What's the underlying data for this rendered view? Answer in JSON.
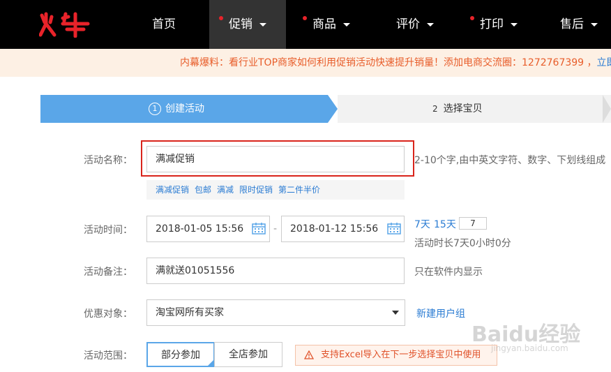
{
  "header": {
    "logo_text": "火牛",
    "nav": [
      {
        "label": "首页",
        "dot": false,
        "caret": false,
        "active": false
      },
      {
        "label": "促销",
        "dot": true,
        "caret": true,
        "active": true
      },
      {
        "label": "商品",
        "dot": true,
        "caret": true,
        "active": false
      },
      {
        "label": "评价",
        "dot": false,
        "caret": true,
        "active": false
      },
      {
        "label": "打印",
        "dot": true,
        "caret": true,
        "active": false
      },
      {
        "label": "售后",
        "dot": false,
        "caret": true,
        "active": false
      }
    ]
  },
  "notice": {
    "text": "内幕爆料：看行业TOP商家如何利用促销活动快速提升销量！添加电商交流圈：1272767399 ，",
    "link": "立即"
  },
  "steps": [
    {
      "number": "1",
      "label": "创建活动",
      "active": true
    },
    {
      "number": "2",
      "label": "选择宝贝",
      "active": false
    }
  ],
  "form": {
    "name": {
      "label": "活动名称：",
      "value": "满减促销",
      "hint": "2-10个字,由中英文字符、数字、下划线组成",
      "quick_tags": [
        "满减促销",
        "包邮",
        "满减",
        "限时促销",
        "第二件半价"
      ]
    },
    "time": {
      "label": "活动时间：",
      "start": "2018-01-05 15:56",
      "separator": "-",
      "end": "2018-01-12 15:56",
      "preset_7": "7天",
      "preset_15": "15天",
      "days_value": "7",
      "duration_text": "活动时长7天0小时0分"
    },
    "remark": {
      "label": "活动备注：",
      "value": "满就送01051556",
      "hint": "只在软件内显示"
    },
    "target": {
      "label": "优惠对象：",
      "selected": "淘宝网所有买家",
      "link": "新建用户组"
    },
    "scope": {
      "label": "活动范围：",
      "option_partial": "部分参加",
      "option_all": "全店参加",
      "warning": "支持Excel导入在下一步选择宝贝中使用"
    }
  },
  "watermark": {
    "text": "Baidu经验",
    "sub": "jingyan.baidu.com"
  },
  "colors": {
    "accent": "#5aa6e8",
    "brand_red": "#e8232a",
    "link": "#2b7cd3",
    "notice_text": "#e85d2a"
  }
}
